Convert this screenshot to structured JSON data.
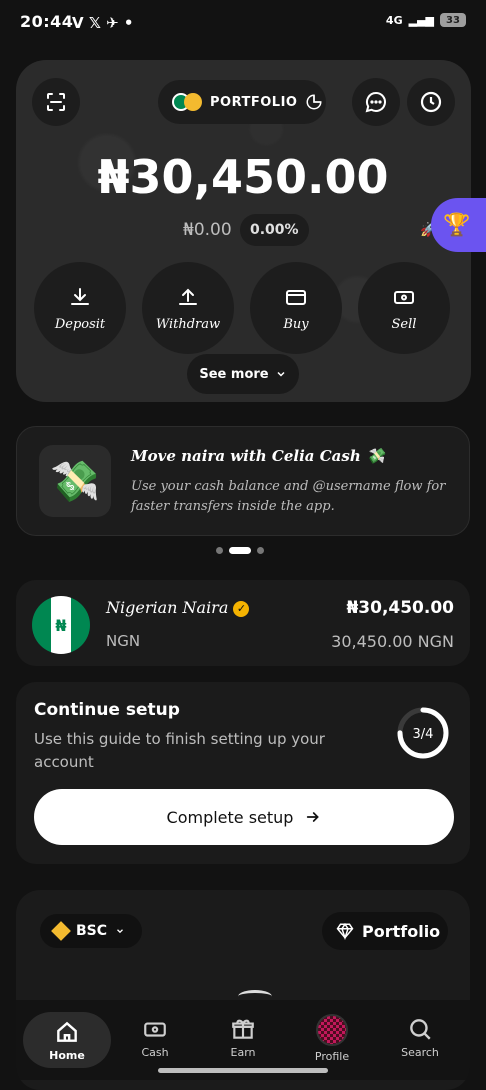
{
  "status_bar": {
    "time": "20:44",
    "app_icons": "V 𝕏 ✈ •",
    "network": "4G",
    "battery": "33"
  },
  "header": {
    "portfolio_label": "PORTFOLIO"
  },
  "balance": {
    "amount": "₦30,450.00",
    "change": "₦0.00",
    "change_pct": "0.00%"
  },
  "actions": [
    {
      "label": "Deposit",
      "icon": "download-icon"
    },
    {
      "label": "Withdraw",
      "icon": "upload-icon"
    },
    {
      "label": "Buy",
      "icon": "card-icon"
    },
    {
      "label": "Sell",
      "icon": "cash-icon"
    }
  ],
  "see_more": "See more",
  "promo": {
    "title": "Move naira with Celia Cash 💸",
    "description": "Use your cash balance and @username flow for faster transfers inside the app.",
    "page_count": 3,
    "active_page": 1
  },
  "account": {
    "name": "Nigerian Naira",
    "code": "NGN",
    "amount": "₦30,450.00",
    "sub_amount": "30,450.00 NGN"
  },
  "setup": {
    "title": "Continue setup",
    "subtitle": "Use this guide to finish setting up your account",
    "progress": "3/4",
    "progress_value": 0.75,
    "button": "Complete setup"
  },
  "assets": {
    "network": "BSC",
    "portfolio": "Portfolio"
  },
  "nav": [
    {
      "label": "Home",
      "icon": "home-icon"
    },
    {
      "label": "Cash",
      "icon": "cash-icon"
    },
    {
      "label": "Earn",
      "icon": "gift-icon"
    },
    {
      "label": "Profile",
      "icon": "avatar-icon"
    },
    {
      "label": "Search",
      "icon": "search-icon"
    }
  ],
  "colors": {
    "accent": "#6b54f0",
    "flag_green": "#008751",
    "verified": "#f5b301"
  }
}
